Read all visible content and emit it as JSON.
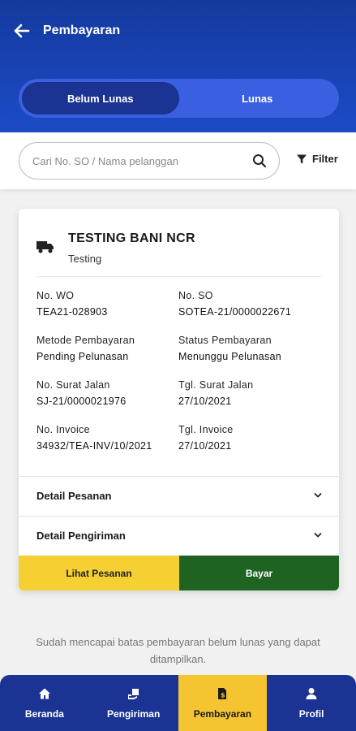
{
  "header": {
    "title": "Pembayaran",
    "back_icon": "arrow-left-icon"
  },
  "tabs": [
    {
      "label": "Belum Lunas",
      "active": true
    },
    {
      "label": "Lunas",
      "active": false
    }
  ],
  "search": {
    "placeholder": "Cari No. SO / Nama pelanggan",
    "value": "",
    "filter_label": "Filter"
  },
  "card": {
    "customer_name": "TESTING BANI NCR",
    "customer_sub": "Testing",
    "fields": {
      "wo_label": "No. WO",
      "wo_value": "TEA21-028903",
      "so_label": "No. SO",
      "so_value": "SOTEA-21/0000022671",
      "metode_label": "Metode Pembayaran",
      "metode_value": "Pending Pelunasan",
      "status_label": "Status Pembayaran",
      "status_value": "Menunggu Pelunasan",
      "sj_label": "No. Surat Jalan",
      "sj_value": "SJ-21/0000021976",
      "tgl_sj_label": "Tgl. Surat Jalan",
      "tgl_sj_value": "27/10/2021",
      "inv_label": "No. Invoice",
      "inv_value": "34932/TEA-INV/10/2021",
      "tgl_inv_label": "Tgl. Invoice",
      "tgl_inv_value": "27/10/2021"
    },
    "detail_pesanan": "Detail Pesanan",
    "detail_pengiriman": "Detail Pengiriman",
    "btn_lihat": "Lihat Pesanan",
    "btn_bayar": "Bayar"
  },
  "notice": "Sudah mencapai batas pembayaran belum lunas yang dapat ditampilkan.",
  "nav": [
    {
      "label": "Beranda",
      "icon": "home-icon",
      "active": false
    },
    {
      "label": "Pengiriman",
      "icon": "delivery-icon",
      "active": false
    },
    {
      "label": "Pembayaran",
      "icon": "invoice-icon",
      "active": true
    },
    {
      "label": "Profil",
      "icon": "user-icon",
      "active": false
    }
  ],
  "colors": {
    "primary": "#1b3493",
    "accent": "#f4c531",
    "pay_button": "#1f6322",
    "lihat_button": "#f4d033"
  }
}
